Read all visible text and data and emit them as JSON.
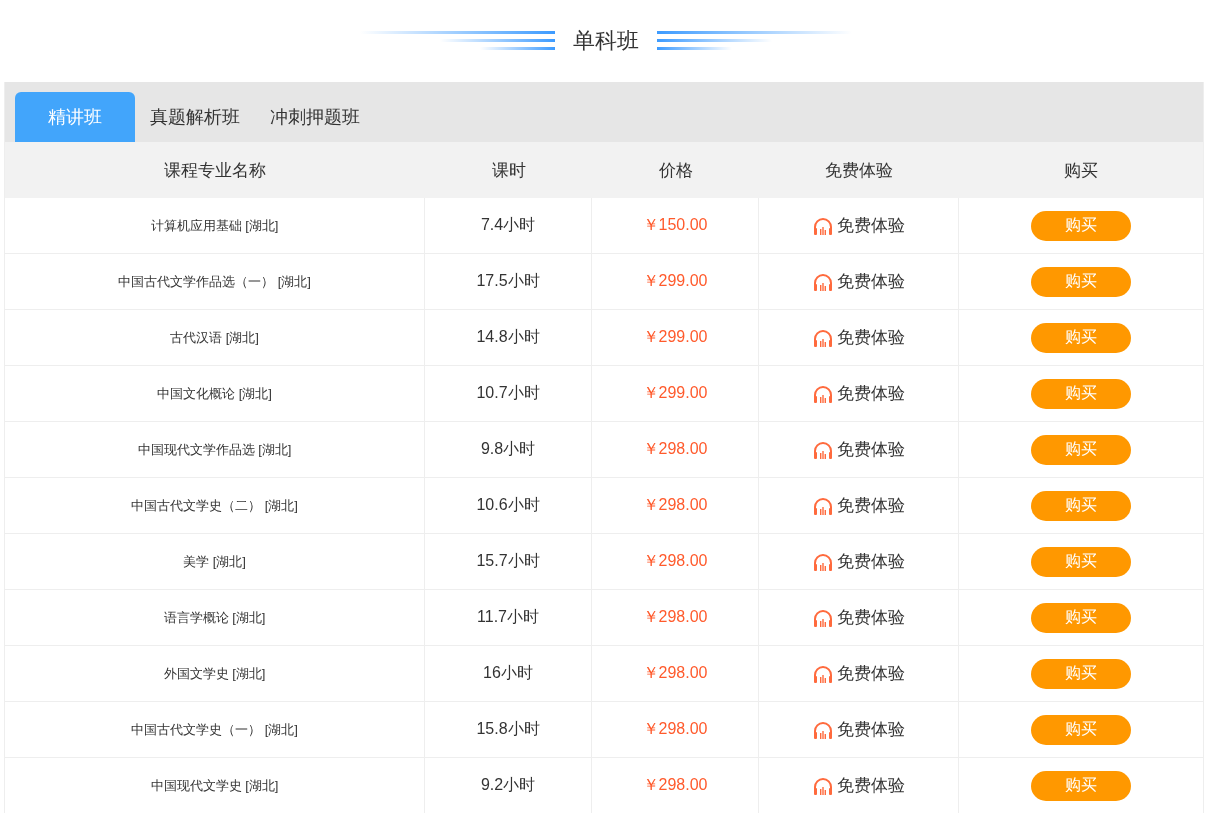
{
  "title": "单科班",
  "tabs": [
    {
      "label": "精讲班",
      "selected": true
    },
    {
      "label": "真题解析班",
      "selected": false
    },
    {
      "label": "冲刺押题班",
      "selected": false
    }
  ],
  "table": {
    "columns": [
      "课程专业名称",
      "课时",
      "价格",
      "免费体验",
      "购买"
    ],
    "rows": [
      {
        "name": "计算机应用基础 [湖北]",
        "hours": "7.4小时",
        "price": "￥150.00",
        "trial": "免费体验",
        "buy": "购买"
      },
      {
        "name": "中国古代文学作品选（一） [湖北]",
        "hours": "17.5小时",
        "price": "￥299.00",
        "trial": "免费体验",
        "buy": "购买"
      },
      {
        "name": "古代汉语 [湖北]",
        "hours": "14.8小时",
        "price": "￥299.00",
        "trial": "免费体验",
        "buy": "购买"
      },
      {
        "name": "中国文化概论 [湖北]",
        "hours": "10.7小时",
        "price": "￥299.00",
        "trial": "免费体验",
        "buy": "购买"
      },
      {
        "name": "中国现代文学作品选 [湖北]",
        "hours": "9.8小时",
        "price": "￥298.00",
        "trial": "免费体验",
        "buy": "购买"
      },
      {
        "name": "中国古代文学史（二） [湖北]",
        "hours": "10.6小时",
        "price": "￥298.00",
        "trial": "免费体验",
        "buy": "购买"
      },
      {
        "name": "美学 [湖北]",
        "hours": "15.7小时",
        "price": "￥298.00",
        "trial": "免费体验",
        "buy": "购买"
      },
      {
        "name": "语言学概论 [湖北]",
        "hours": "11.7小时",
        "price": "￥298.00",
        "trial": "免费体验",
        "buy": "购买"
      },
      {
        "name": "外国文学史 [湖北]",
        "hours": "16小时",
        "price": "￥298.00",
        "trial": "免费体验",
        "buy": "购买"
      },
      {
        "name": "中国古代文学史（一） [湖北]",
        "hours": "15.8小时",
        "price": "￥298.00",
        "trial": "免费体验",
        "buy": "购买"
      },
      {
        "name": "中国现代文学史 [湖北]",
        "hours": "9.2小时",
        "price": "￥298.00",
        "trial": "免费体验",
        "buy": "购买"
      }
    ]
  }
}
